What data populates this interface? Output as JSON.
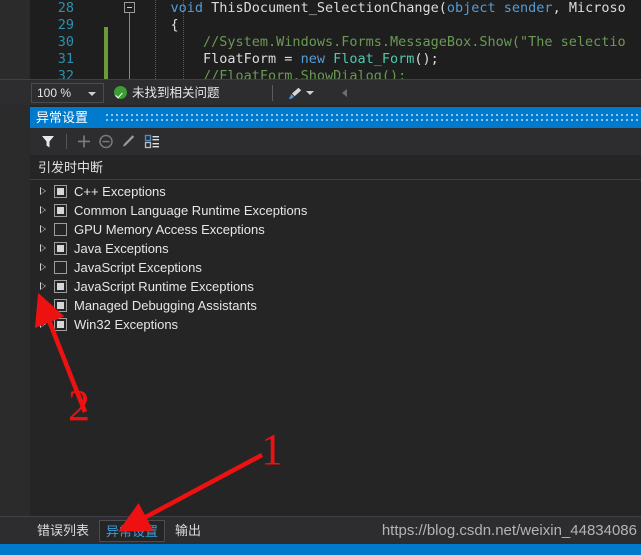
{
  "editor": {
    "lines": [
      {
        "number": "28",
        "segments": [
          {
            "text": "    ",
            "cls": "tok-plain"
          },
          {
            "text": "void",
            "cls": "tok-kw"
          },
          {
            "text": " ThisDocument_SelectionChange(",
            "cls": "tok-plain"
          },
          {
            "text": "object",
            "cls": "tok-kw"
          },
          {
            "text": " ",
            "cls": "tok-plain"
          },
          {
            "text": "sender",
            "cls": "tok-kw"
          },
          {
            "text": ", Microso",
            "cls": "tok-plain"
          }
        ]
      },
      {
        "number": "29",
        "segments": [
          {
            "text": "    {",
            "cls": "tok-plain"
          }
        ]
      },
      {
        "number": "30",
        "segments": [
          {
            "text": "        ",
            "cls": "tok-plain"
          },
          {
            "text": "//System.Windows.Forms.MessageBox.Show(\"The selectio",
            "cls": "tok-comment"
          }
        ]
      },
      {
        "number": "31",
        "segments": [
          {
            "text": "        FloatForm = ",
            "cls": "tok-plain"
          },
          {
            "text": "new",
            "cls": "tok-kw"
          },
          {
            "text": " ",
            "cls": "tok-plain"
          },
          {
            "text": "Float_Form",
            "cls": "tok-class"
          },
          {
            "text": "();",
            "cls": "tok-plain"
          }
        ]
      },
      {
        "number": "32",
        "segments": [
          {
            "text": "        ",
            "cls": "tok-plain"
          },
          {
            "text": "//FloatForm.ShowDialog();",
            "cls": "tok-comment"
          }
        ]
      }
    ]
  },
  "statusbar": {
    "zoom_level": "100 %",
    "status_text": "未找到相关问题"
  },
  "panel": {
    "title": "异常设置",
    "toolbar": {
      "filter_tooltip": "筛选",
      "add_tooltip": "添加",
      "remove_tooltip": "删除",
      "edit_tooltip": "编辑条件",
      "categories_tooltip": "显示类别"
    },
    "column_header": "引发时中断",
    "rows": [
      {
        "label": "C++ Exceptions",
        "checked": "partial"
      },
      {
        "label": "Common Language Runtime Exceptions",
        "checked": "partial"
      },
      {
        "label": "GPU Memory Access Exceptions",
        "checked": "empty"
      },
      {
        "label": "Java Exceptions",
        "checked": "partial"
      },
      {
        "label": "JavaScript Exceptions",
        "checked": "empty"
      },
      {
        "label": "JavaScript Runtime Exceptions",
        "checked": "partial"
      },
      {
        "label": "Managed Debugging Assistants",
        "checked": "partial"
      },
      {
        "label": "Win32 Exceptions",
        "checked": "partial"
      }
    ]
  },
  "tabbar": {
    "tabs": [
      {
        "label": "错误列表",
        "active": false
      },
      {
        "label": "异常设置",
        "active": true
      },
      {
        "label": "输出",
        "active": false
      }
    ],
    "watermark": "https://blog.csdn.net/weixin_44834086"
  },
  "annotations": [
    {
      "number": "1"
    },
    {
      "number": "2"
    }
  ],
  "colors": {
    "accent": "#007acc",
    "annotation": "#ee1111",
    "panel_bg": "#252526",
    "editor_bg": "#1e1e1e"
  }
}
